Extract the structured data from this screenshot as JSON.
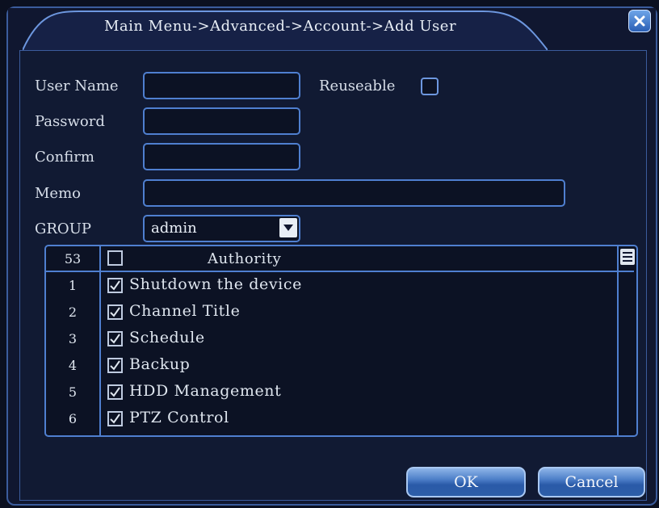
{
  "window": {
    "title": "Main Menu->Advanced->Account->Add User"
  },
  "form": {
    "user_name_label": "User Name",
    "user_name_value": "",
    "reuseable_label": "Reuseable",
    "reuseable_checked": false,
    "password_label": "Password",
    "password_value": "",
    "confirm_label": "Confirm",
    "confirm_value": "",
    "memo_label": "Memo",
    "memo_value": "",
    "group_label": "GROUP",
    "group_value": "admin"
  },
  "authority": {
    "count": "53",
    "header": "Authority",
    "rows": [
      {
        "num": "1",
        "label": "Shutdown the device",
        "checked": true
      },
      {
        "num": "2",
        "label": "Channel Title",
        "checked": true
      },
      {
        "num": "3",
        "label": "Schedule",
        "checked": true
      },
      {
        "num": "4",
        "label": "Backup",
        "checked": true
      },
      {
        "num": "5",
        "label": "HDD Management",
        "checked": true
      },
      {
        "num": "6",
        "label": "PTZ Control",
        "checked": true
      }
    ]
  },
  "buttons": {
    "ok": "OK",
    "cancel": "Cancel"
  },
  "icons": {
    "close": "close-icon",
    "dropdown": "chevron-down-icon",
    "list_menu": "list-icon",
    "check": "check-icon"
  },
  "colors": {
    "background": "#101730",
    "accent_border": "#4f7fd0",
    "button": "#2a5aa8"
  }
}
